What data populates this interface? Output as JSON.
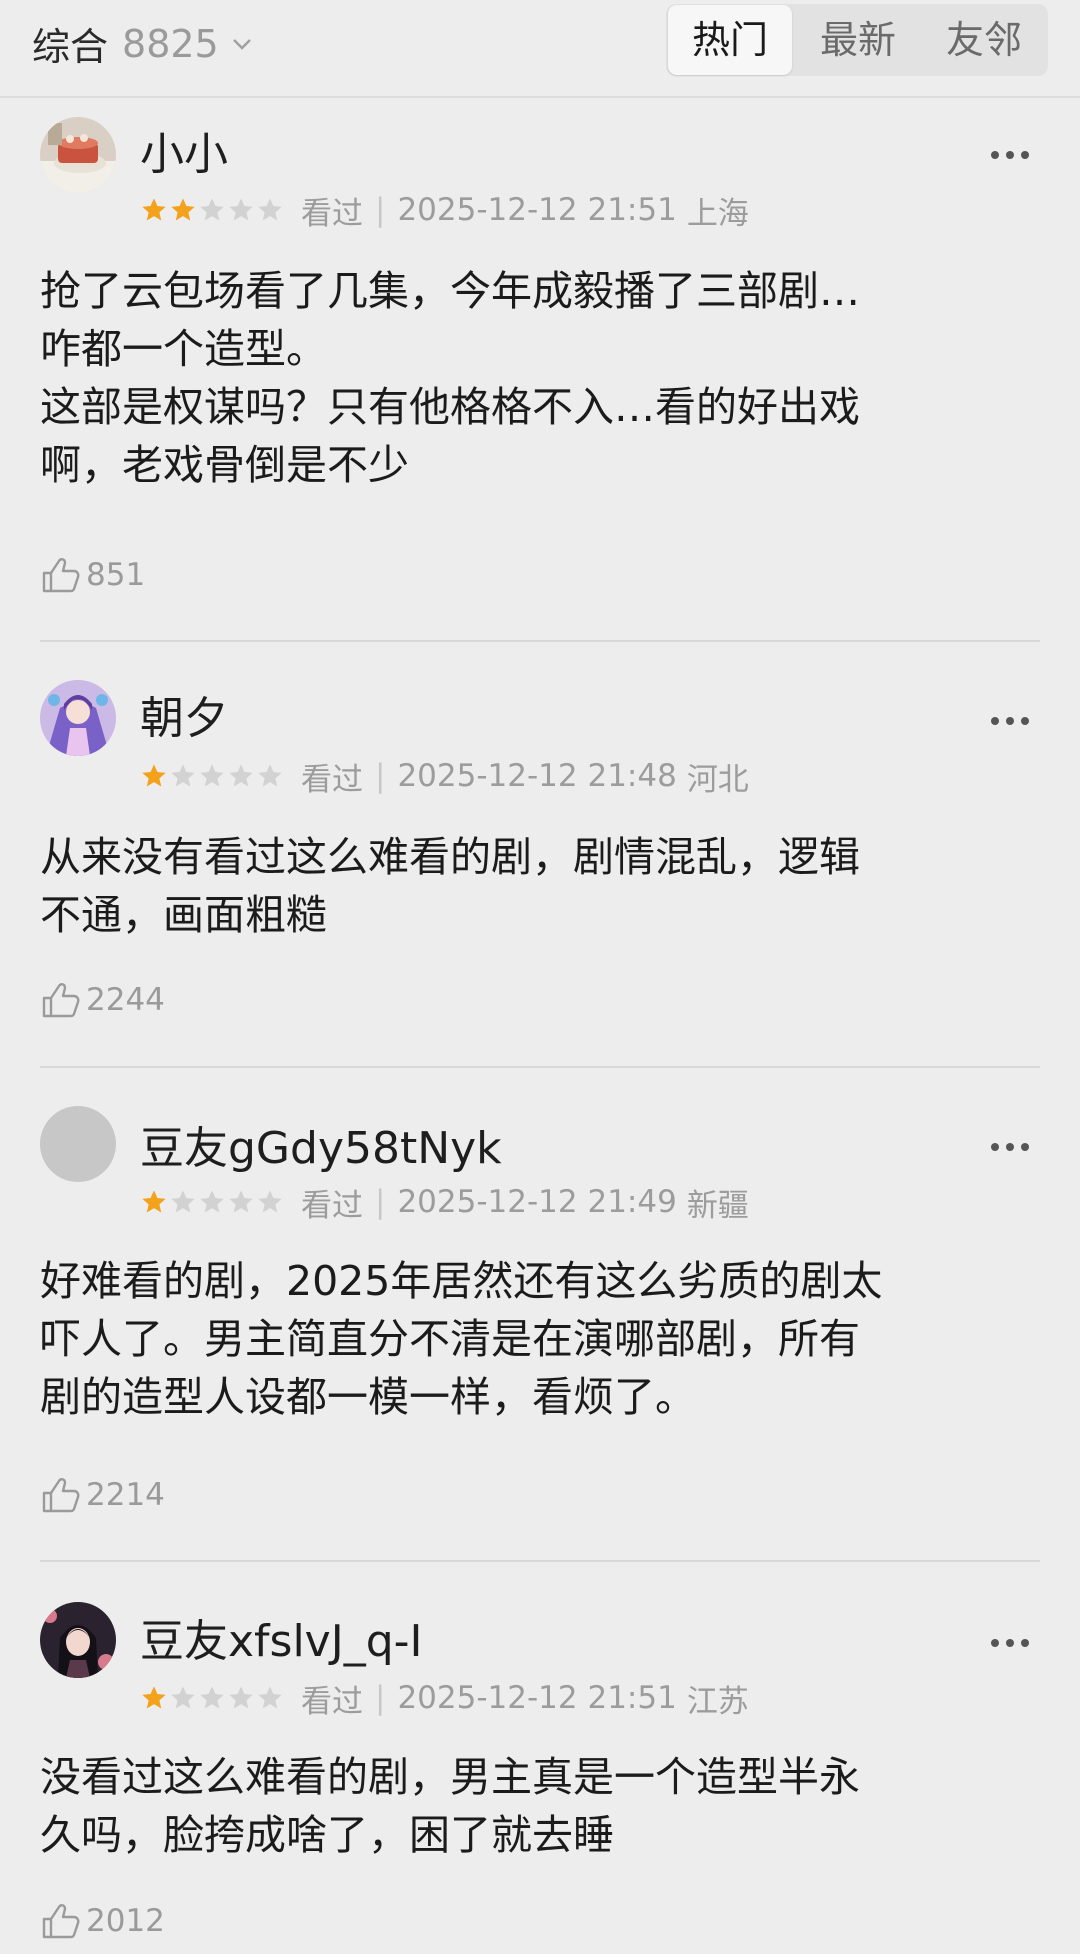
{
  "header": {
    "sort_label": "综合",
    "count": "8825",
    "tabs": [
      {
        "label": "热门",
        "active": true
      },
      {
        "label": "最新",
        "active": false
      },
      {
        "label": "友邻",
        "active": false
      }
    ]
  },
  "colors": {
    "star_on": "#f4a11b",
    "star_off": "#d2d2d2",
    "background": "#ededed"
  },
  "reviews": [
    {
      "username": "小小",
      "rating": 2,
      "status": "看过",
      "datetime": "2025-12-12 21:51",
      "location": "上海",
      "content": [
        "抢了云包场看了几集，今年成毅播了三部剧…",
        "咋都一个造型。",
        "这部是权谋吗？只有他格格不入…看的好出戏",
        "啊，老戏骨倒是不少"
      ],
      "likes": "851",
      "avatar_icon": "cake-photo-avatar"
    },
    {
      "username": "朝夕",
      "rating": 1,
      "status": "看过",
      "datetime": "2025-12-12 21:48",
      "location": "河北",
      "content": [
        "从来没有看过这么难看的剧，剧情混乱，逻辑",
        "不通，画面粗糙"
      ],
      "likes": "2244",
      "avatar_icon": "anime-girl-avatar"
    },
    {
      "username": "豆友gGdy58tNyk",
      "rating": 1,
      "status": "看过",
      "datetime": "2025-12-12 21:49",
      "location": "新疆",
      "content": [
        "好难看的剧，2025年居然还有这么劣质的剧太",
        "吓人了。男主简直分不清是在演哪部剧，所有",
        "剧的造型人设都一模一样，看烦了。"
      ],
      "likes": "2214",
      "avatar_icon": "default-grey-avatar"
    },
    {
      "username": "豆友xfslvJ_q-I",
      "rating": 1,
      "status": "看过",
      "datetime": "2025-12-12 21:51",
      "location": "江苏",
      "content": [
        "没看过这么难看的剧，男主真是一个造型半永",
        "久吗，脸挎成啥了，困了就去睡"
      ],
      "likes": "2012",
      "avatar_icon": "anime-portrait-avatar"
    }
  ]
}
